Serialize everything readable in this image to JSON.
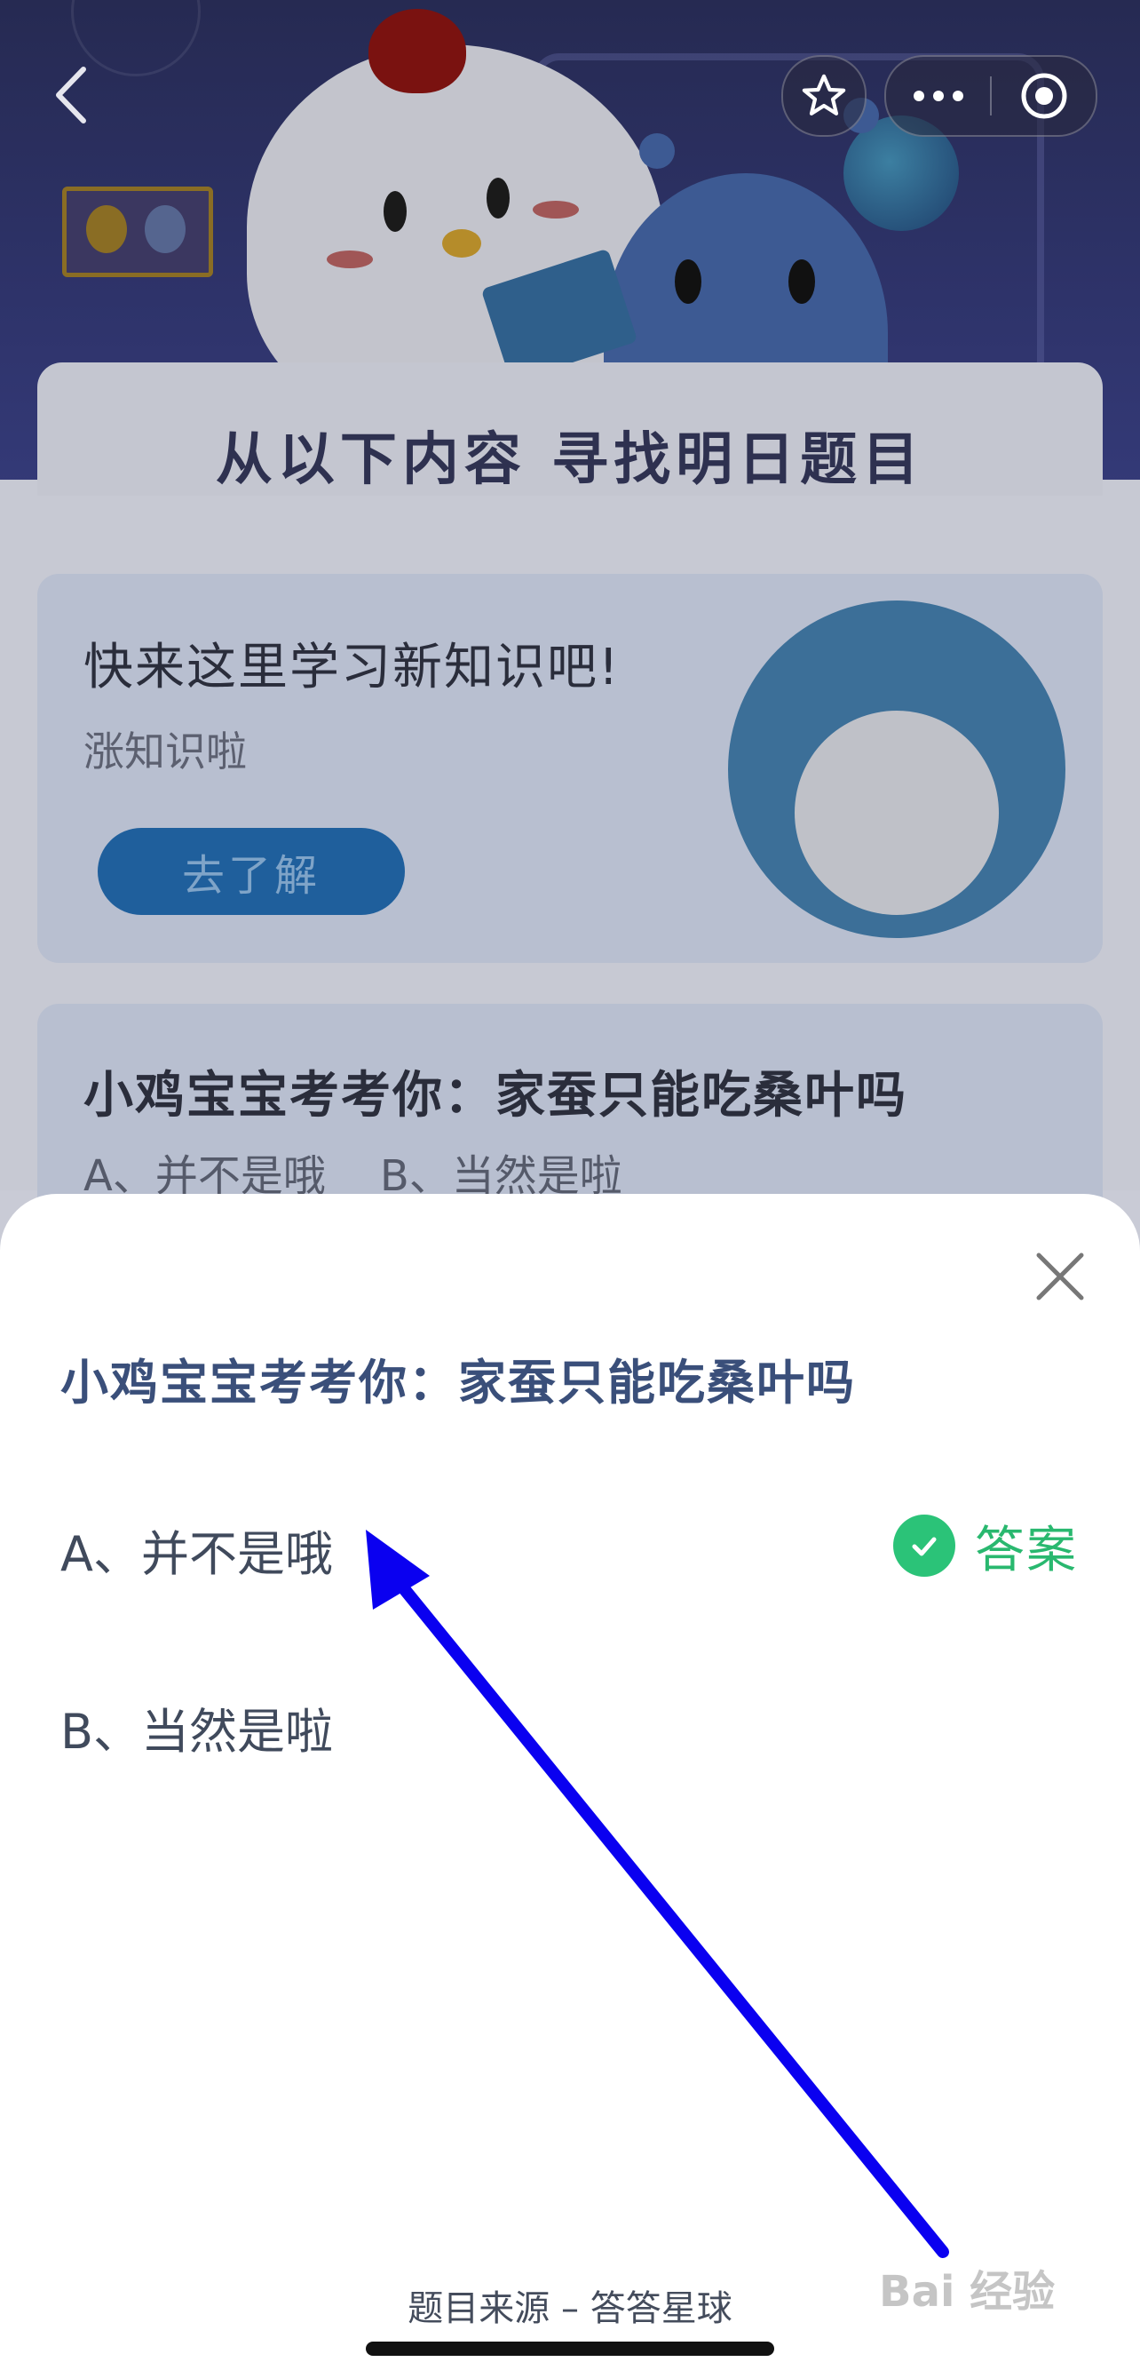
{
  "header": {
    "find_title": "从以下内容  寻找明日题目"
  },
  "learn_card": {
    "title": "快来这里学习新知识吧!",
    "subtitle": "涨知识啦",
    "button_label": "去了解"
  },
  "background_quiz": {
    "question": "小鸡宝宝考考你：家蚕只能吃桑叶吗",
    "options_line": "A、并不是哦    B、当然是啦"
  },
  "sheet": {
    "question": "小鸡宝宝考考你：家蚕只能吃桑叶吗",
    "options": [
      {
        "label": "A、并不是哦",
        "is_answer": true
      },
      {
        "label": "B、当然是啦",
        "is_answer": false
      }
    ],
    "answer_label": "答案",
    "source": "题目来源 – 答答星球"
  },
  "watermark": "Bai 经验",
  "colors": {
    "answer_green": "#2bc378",
    "annotation_arrow": "#0a00f0",
    "title_blue": "#3a4f7a"
  },
  "icons": [
    "back-icon",
    "star-icon",
    "more-icon",
    "target-icon",
    "close-icon",
    "check-icon"
  ]
}
